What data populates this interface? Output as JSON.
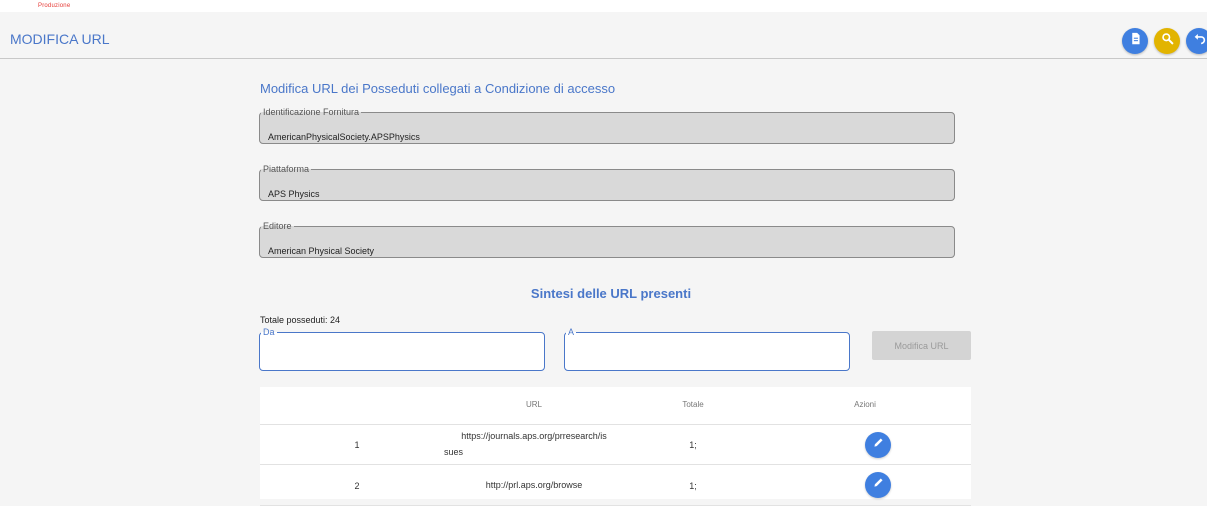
{
  "header": {
    "top_mini_text": "Produzione",
    "title": "MODIFICA URL",
    "buttons": [
      {
        "icon": "document-icon",
        "color": "#3f7fe0"
      },
      {
        "icon": "search-icon",
        "color": "#e2b400"
      },
      {
        "icon": "undo-icon",
        "color": "#3f7fe0"
      }
    ]
  },
  "page": {
    "subtitle": "Modifica URL dei Posseduti collegati a Condizione di accesso"
  },
  "fields": {
    "identificazione": {
      "label": "Identificazione Fornitura",
      "value": "AmericanPhysicalSociety.APSPhysics"
    },
    "piattaforma": {
      "label": "Piattaforma",
      "value": "APS Physics"
    },
    "editore": {
      "label": "Editore",
      "value": "American Physical Society"
    }
  },
  "summary": {
    "title": "Sintesi delle URL presenti",
    "totale_label": "Totale posseduti: 24",
    "da": {
      "label": "Da",
      "value": ""
    },
    "a": {
      "label": "A",
      "value": ""
    },
    "modify_button": "Modifica URL"
  },
  "table": {
    "headers": {
      "num": "",
      "url": "URL",
      "totale": "Totale",
      "azioni": "Azioni"
    },
    "rows": [
      {
        "num": "1",
        "url_line1": "https://journals.aps.org/prresearch/is",
        "url_line2": "sues",
        "totale": "1;"
      },
      {
        "num": "2",
        "url_line1": "http://prl.aps.org/browse",
        "url_line2": "",
        "totale": "1;"
      }
    ]
  },
  "colors": {
    "accent": "#4a77c9",
    "primary_button": "#3f7fe0",
    "search_button": "#e2b400"
  }
}
